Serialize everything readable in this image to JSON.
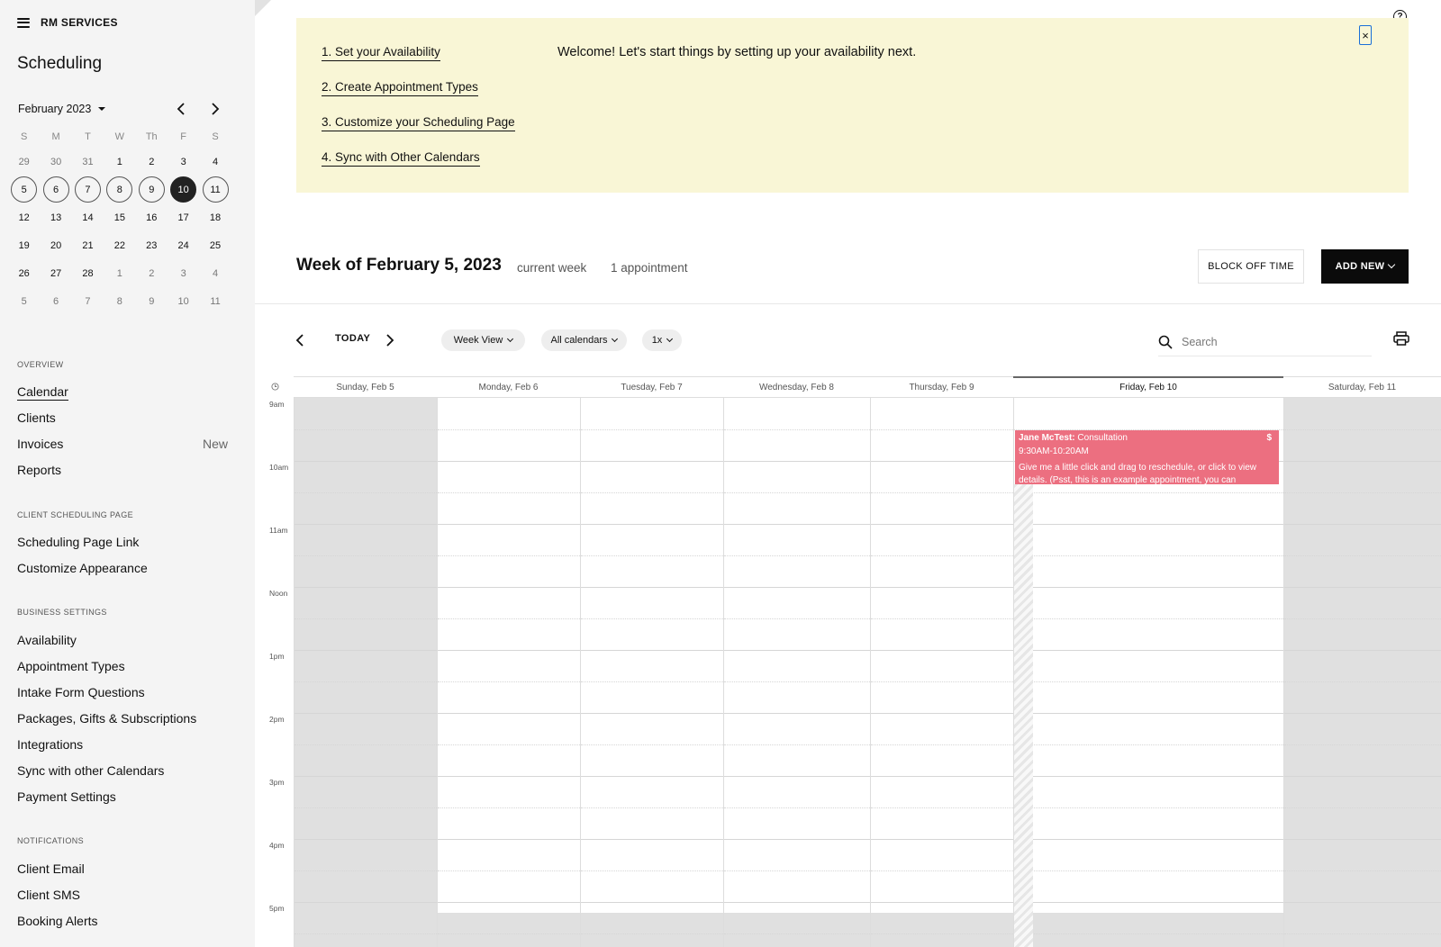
{
  "sidebar": {
    "brand": "RM SERVICES",
    "title": "Scheduling",
    "mini_calendar": {
      "month_label": "February 2023",
      "weekdays": [
        "S",
        "M",
        "T",
        "W",
        "Th",
        "F",
        "S"
      ],
      "weeks": [
        [
          "29",
          "30",
          "31",
          "1",
          "2",
          "3",
          "4"
        ],
        [
          "5",
          "6",
          "7",
          "8",
          "9",
          "10",
          "11"
        ],
        [
          "12",
          "13",
          "14",
          "15",
          "16",
          "17",
          "18"
        ],
        [
          "19",
          "20",
          "21",
          "22",
          "23",
          "24",
          "25"
        ],
        [
          "26",
          "27",
          "28",
          "1",
          "2",
          "3",
          "4"
        ],
        [
          "5",
          "6",
          "7",
          "8",
          "9",
          "10",
          "11"
        ]
      ],
      "selected_day": "10"
    },
    "sections": {
      "overview": {
        "label": "OVERVIEW",
        "items": [
          "Calendar",
          "Clients",
          "Invoices",
          "Reports"
        ],
        "invoices_badge": "New"
      },
      "client_page": {
        "label": "CLIENT SCHEDULING PAGE",
        "items": [
          "Scheduling Page Link",
          "Customize Appearance"
        ]
      },
      "business": {
        "label": "BUSINESS SETTINGS",
        "items": [
          "Availability",
          "Appointment Types",
          "Intake Form Questions",
          "Packages, Gifts & Subscriptions",
          "Integrations",
          "Sync with other Calendars",
          "Payment Settings"
        ]
      },
      "notifications": {
        "label": "NOTIFICATIONS",
        "items": [
          "Client Email",
          "Client SMS",
          "Booking Alerts"
        ]
      }
    }
  },
  "banner": {
    "steps": [
      "1. Set your Availability",
      "2. Create Appointment Types",
      "3. Customize your Scheduling Page",
      "4. Sync with Other Calendars"
    ],
    "welcome": "Welcome! Let's start things by setting up your availability next.",
    "close": "×"
  },
  "header": {
    "help": "?",
    "week_title": "Week of February 5, 2023",
    "current_week": "current week",
    "appointment_count": "1 appointment",
    "block_off": "BLOCK OFF TIME",
    "add_new": "ADD NEW"
  },
  "toolbar": {
    "today": "TODAY",
    "view": "Week View",
    "calendars": "All calendars",
    "zoom": "1x",
    "search_placeholder": "Search"
  },
  "calendar": {
    "days": [
      "Sunday, Feb 5",
      "Monday, Feb 6",
      "Tuesday, Feb 7",
      "Wednesday, Feb 8",
      "Thursday, Feb 9",
      "Friday, Feb 10",
      "Saturday, Feb 11"
    ],
    "hours": [
      "9am",
      "10am",
      "11am",
      "Noon",
      "1pm",
      "2pm",
      "3pm",
      "4pm",
      "5pm"
    ],
    "appointment": {
      "client": "Jane McTest:",
      "type": "Consultation",
      "time": "9:30AM-10:20AM",
      "note": "Give me a little click and drag to reschedule, or click to view details. (Psst, this is an example appointment, you can",
      "paid_icon": "$"
    }
  },
  "colors": {
    "banner_bg": "#f9f6d6",
    "appointment": "#ec6f80",
    "sidebar_bg": "#f4f4f4",
    "closed_bg": "#e0e0e0",
    "primary_button": "#0b0b0b"
  }
}
